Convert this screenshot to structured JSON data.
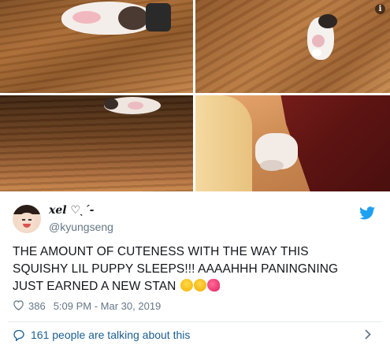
{
  "tweet": {
    "display_name": "xel ♡ˎˊ-",
    "handle": "@kyungseng",
    "text_line1": "THE AMOUNT OF CUTENESS WITH THE WAY THIS",
    "text_line2": "SQUISHY LIL PUPPY SLEEPS!!! AAAAHHH PANINGNING",
    "text_line3": "JUST EARNED A NEW STAN",
    "likes": "386",
    "timestamp": "5:09 PM - Mar 30, 2019",
    "talking": "161 people are talking about this"
  },
  "icons": {
    "info": "i",
    "twitter": "twitter-bird-icon",
    "heart": "heart-outline-icon",
    "comment": "speech-bubble-icon",
    "chevron": "chevron-right-icon"
  },
  "colors": {
    "link": "#1b5f93",
    "twitter_blue": "#1da1f2",
    "meta": "#657786"
  }
}
